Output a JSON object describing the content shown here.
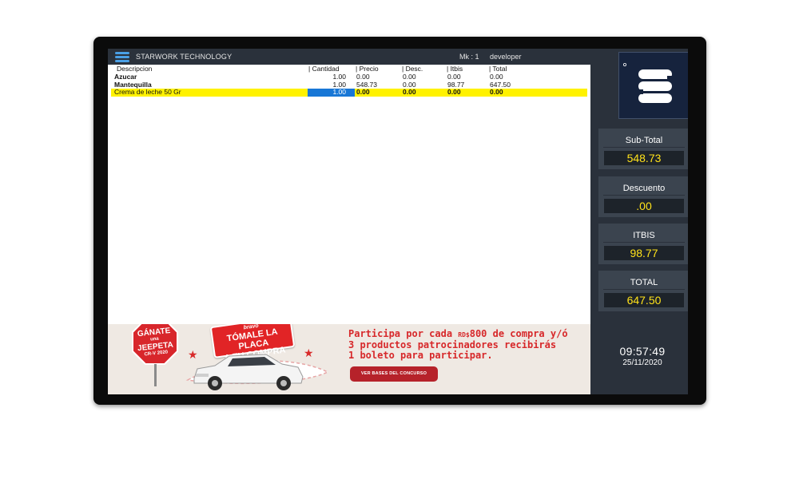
{
  "header": {
    "brand": "STARWORK TECHNOLOGY",
    "station": "Mk : 1",
    "user": "developer"
  },
  "table": {
    "columns": [
      "Descripcion",
      "| Cantidad",
      "| Precio",
      "| Desc.",
      "| Itbis",
      "| Total"
    ],
    "rows": [
      {
        "desc": "Azucar",
        "cantidad": "1.00",
        "precio": "0.00",
        "descuento": "0.00",
        "itbis": "0.00",
        "total": "0.00"
      },
      {
        "desc": "Mantequilla",
        "cantidad": "1.00",
        "precio": "548.73",
        "descuento": "0.00",
        "itbis": "98.77",
        "total": "647.50"
      },
      {
        "desc": "Crema de leche 50 Gr",
        "cantidad": "1.00",
        "precio": "0.00",
        "descuento": "0.00",
        "itbis": "0.00",
        "total": "0.00"
      }
    ],
    "selected_row": 2
  },
  "banner": {
    "sign_line1": "GÁNATE",
    "sign_small": "una",
    "sign_line2": "JEEPETA",
    "sign_line3": "CR-V 2020",
    "plate_brand": "bravo",
    "plate_line1": "TÓMALE LA PLACA",
    "plate_line2": "A TU COMPRA",
    "promo_line1_a": "Participa por cada ",
    "promo_currency": "RD$",
    "promo_line1_b": "800 de compra y/ó",
    "promo_line2": "3 productos patrocinadores recibirás",
    "promo_line3": "1 boleto para participar.",
    "cta": "VER BASES DEL CONCURSO"
  },
  "totals": {
    "subtotal_label": "Sub-Total",
    "subtotal_value": "548.73",
    "descuento_label": "Descuento",
    "descuento_value": ".00",
    "itbis_label": "ITBIS",
    "itbis_value": "98.77",
    "total_label": "TOTAL",
    "total_value": "647.50"
  },
  "clock": {
    "time": "09:57:49",
    "date": "25/11/2020"
  },
  "colors": {
    "header_bg": "#2a313b",
    "selected_row": "#fff200",
    "selected_cell": "#1877d6",
    "value_text": "#ffe21a",
    "promo_red": "#d7282a"
  },
  "icons": {
    "brand_logo": "starwork-s-logo"
  }
}
